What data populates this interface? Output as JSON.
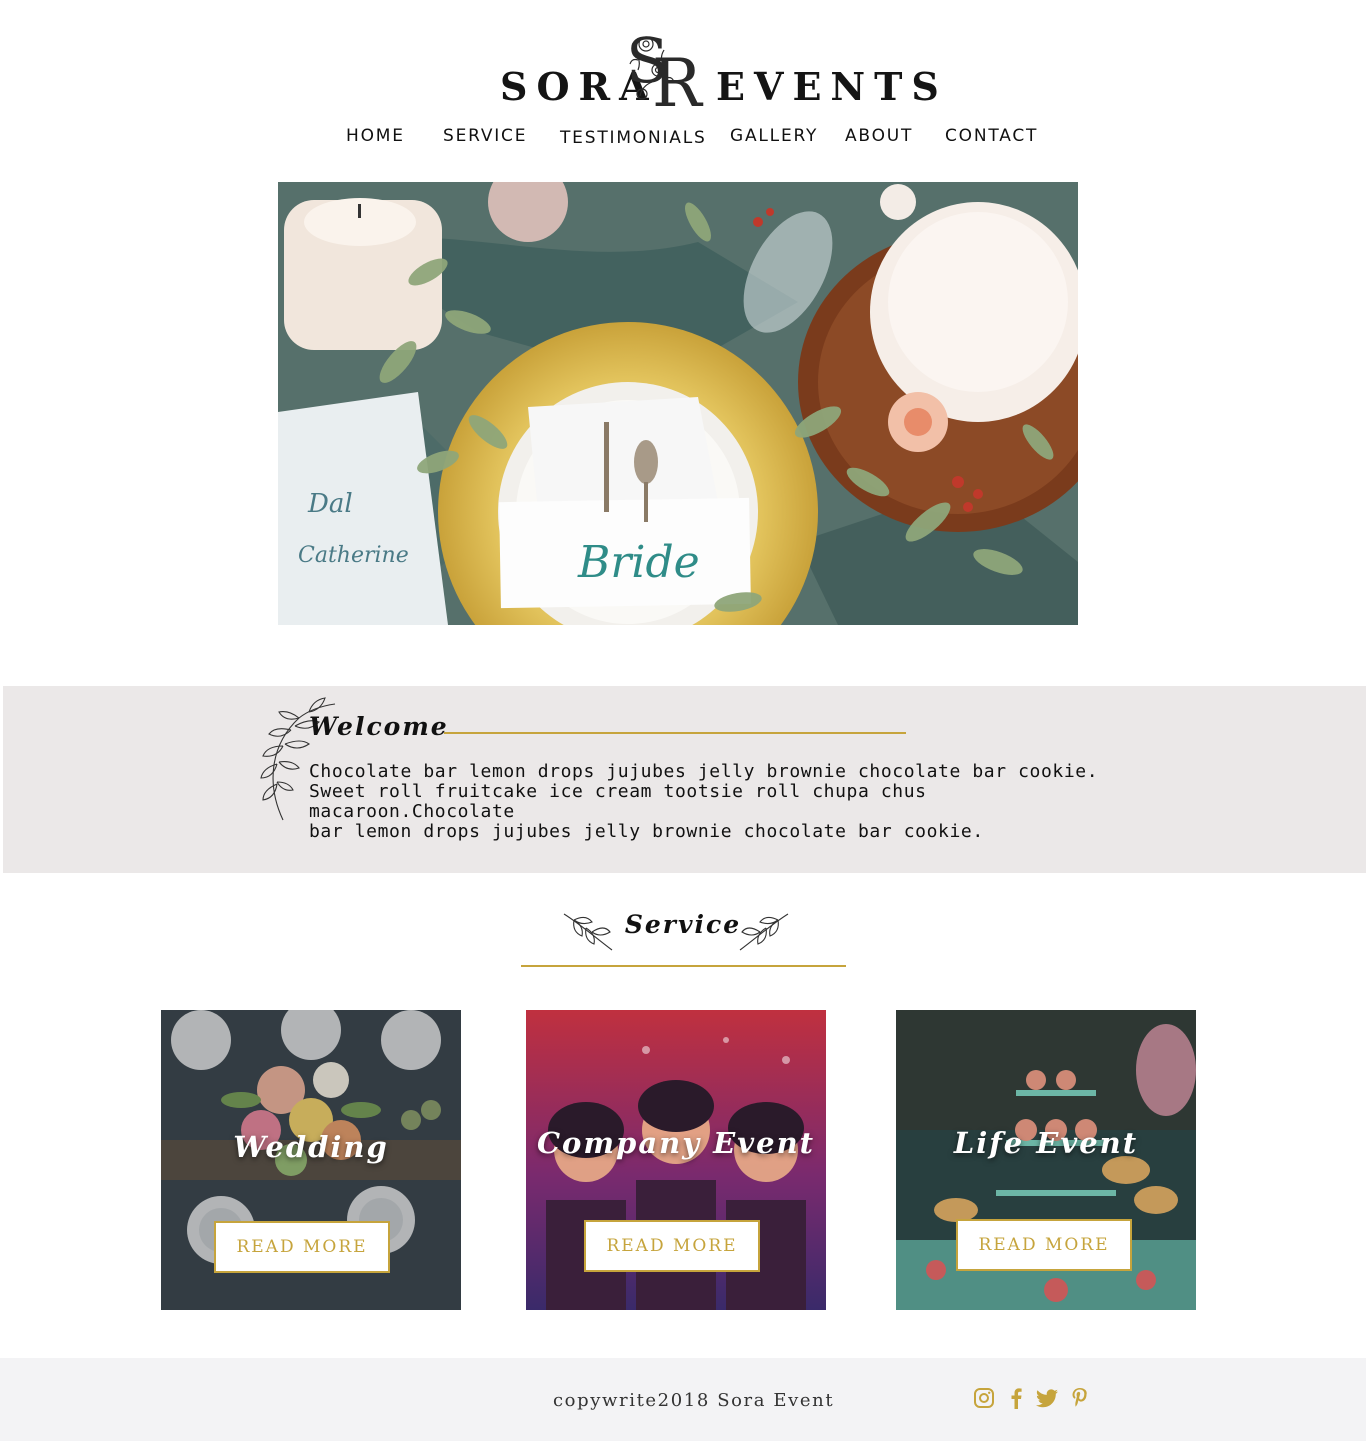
{
  "brand": {
    "left_word": "SORA",
    "right_word": "EVENTS",
    "monogram": "SR"
  },
  "nav": {
    "items": [
      {
        "label": "HOME"
      },
      {
        "label": "SERVICE"
      },
      {
        "label": "TESTIMONIALS"
      },
      {
        "label": "GALLERY"
      },
      {
        "label": "ABOUT"
      },
      {
        "label": "CONTACT"
      }
    ]
  },
  "hero": {
    "image": "wedding-table-place-setting",
    "place_card_text": "Bride"
  },
  "welcome": {
    "title": "Welcome",
    "lines": [
      "Chocolate bar lemon drops jujubes jelly brownie chocolate bar cookie.",
      "Sweet roll fruitcake ice cream tootsie roll chupa chus macaroon.Chocolate",
      "bar lemon drops jujubes jelly brownie chocolate bar cookie."
    ]
  },
  "service": {
    "title": "Service",
    "cards": [
      {
        "title": "Wedding",
        "button": "READ MORE",
        "image": "wedding-table-flowers"
      },
      {
        "title": "Company Event",
        "button": "READ MORE",
        "image": "masquerade-party"
      },
      {
        "title": "Life Event",
        "button": "READ MORE",
        "image": "dessert-table"
      }
    ]
  },
  "footer": {
    "copyright": "copywrite2018 Sora Event",
    "social": [
      "instagram-icon",
      "facebook-icon",
      "twitter-icon",
      "pinterest-icon"
    ]
  },
  "colors": {
    "accent_gold": "#c6a43c",
    "band_gray": "#ebe8e8",
    "footer_bg": "#f3f3f5",
    "text": "#111111"
  }
}
